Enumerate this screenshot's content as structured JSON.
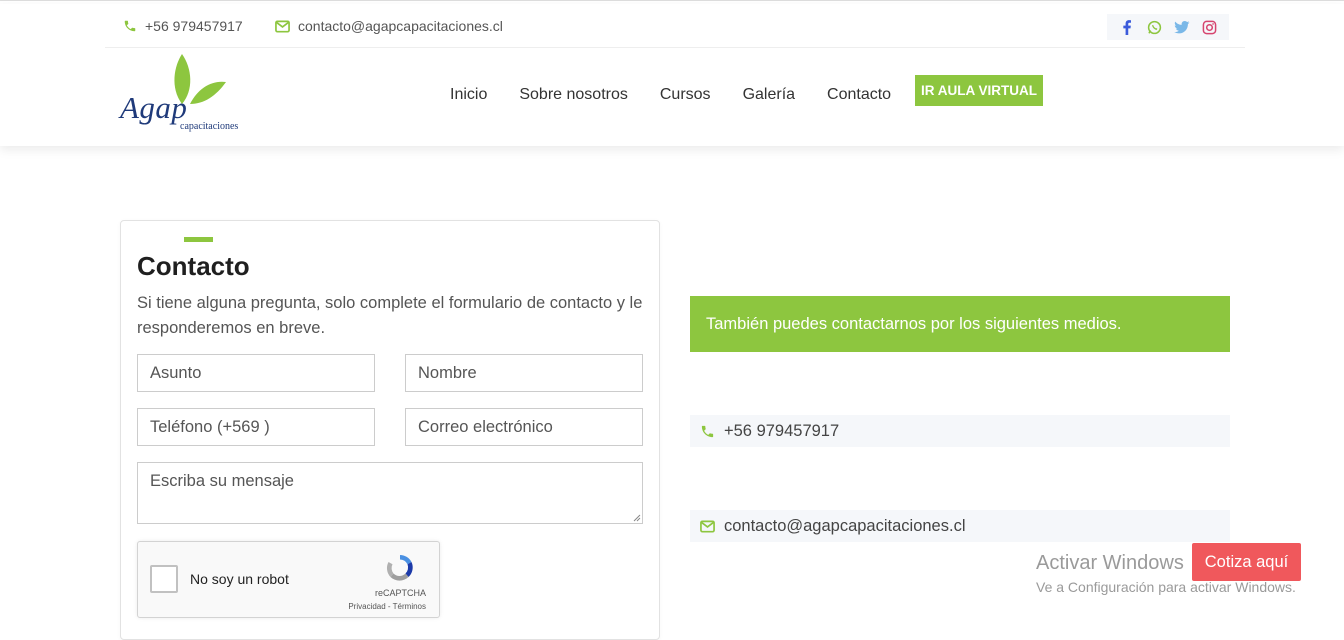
{
  "topbar": {
    "phone": "+56 979457917",
    "email": "contacto@agapcapacitaciones.cl",
    "social": [
      "facebook-icon",
      "whatsapp-icon",
      "twitter-icon",
      "instagram-icon"
    ]
  },
  "logo": {
    "name": "Agap",
    "subtitle": "capacitaciones"
  },
  "nav": {
    "items": [
      "Inicio",
      "Sobre nosotros",
      "Cursos",
      "Galería",
      "Contacto"
    ],
    "cta": "IR AULA VIRTUAL"
  },
  "form": {
    "title": "Contacto",
    "description": "Si tiene alguna pregunta, solo complete el formulario de contacto y le responderemos en breve.",
    "subject_placeholder": "Asunto",
    "name_placeholder": "Nombre",
    "phone_placeholder": "Teléfono (+569 )",
    "email_placeholder": "Correo electrónico",
    "message_placeholder": "Escriba su mensaje",
    "captcha": {
      "label": "No soy un robot",
      "brand": "reCAPTCHA",
      "links": "Privacidad - Términos"
    }
  },
  "contact_info": {
    "intro": "También puedes contactarnos por los siguientes medios.",
    "phone": "+56 979457917",
    "email": "contacto@agapcapacitaciones.cl"
  },
  "windows_watermark": {
    "title": "Activar Windows",
    "subtitle": "Ve a Configuración para activar Windows."
  },
  "floating_button": "Cotiza aquí",
  "colors": {
    "accent": "#8dc63f",
    "brand_blue": "#1f3a7a",
    "cta_red": "#f0585c"
  }
}
